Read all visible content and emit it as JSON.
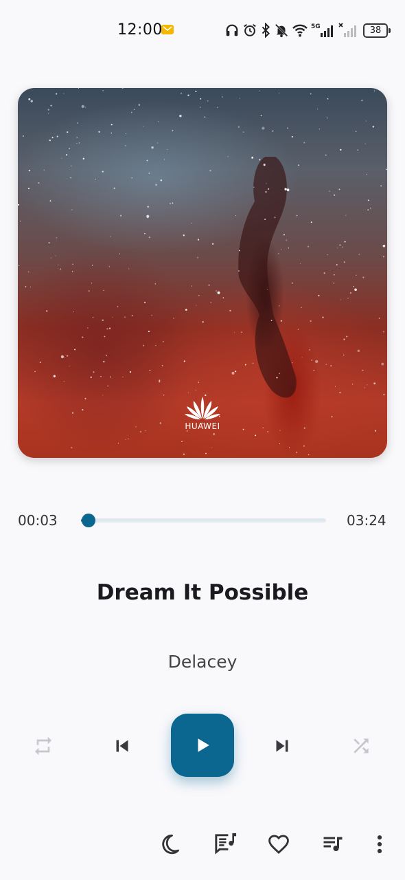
{
  "status_bar": {
    "time": "12:00",
    "battery": "38",
    "network": "5G"
  },
  "album": {
    "brand": "HUAWEI"
  },
  "player": {
    "current_time": "00:03",
    "total_time": "03:24",
    "progress_fraction": 0.015,
    "title": "Dream It Possible",
    "artist": "Delacey"
  },
  "colors": {
    "accent": "#0b6690",
    "background": "#f9f9fc",
    "track": "#e1e9f0",
    "disabled_icon": "#c4c7cc"
  },
  "icons": {
    "controls": [
      "repeat-icon",
      "previous-icon",
      "play-icon",
      "next-icon",
      "shuffle-icon"
    ],
    "bottom": [
      "sleep-timer-icon",
      "lyrics-icon",
      "favorite-icon",
      "queue-icon",
      "more-icon"
    ]
  }
}
